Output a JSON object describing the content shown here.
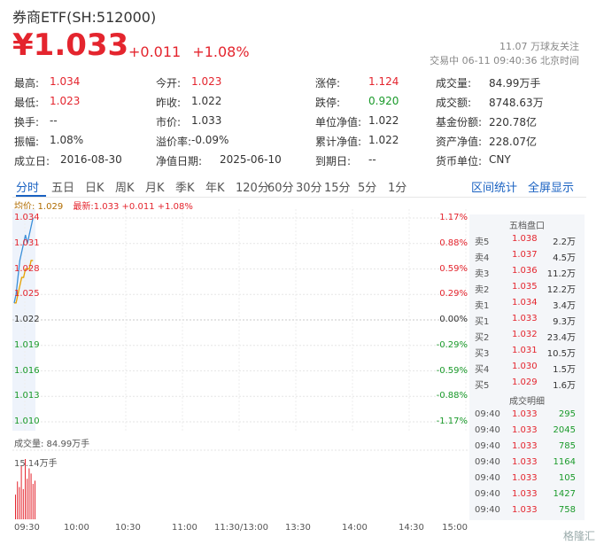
{
  "header": {
    "title": "券商ETF(SH:512000)",
    "price": "¥1.033",
    "change": "+0.011",
    "change_pct": "+1.08%",
    "followers": "11.07 万球友关注",
    "trading_status": "交易中  06-11  09:40:36  北京时间"
  },
  "stats": [
    [
      {
        "label": "最高:",
        "value": "1.034",
        "color": "red"
      },
      {
        "label": "今开:",
        "value": "1.023",
        "color": "red"
      },
      {
        "label": "涨停:",
        "value": "1.124",
        "color": "red"
      },
      {
        "label": "成交量:",
        "value": "84.99万手",
        "color": ""
      }
    ],
    [
      {
        "label": "最低:",
        "value": "1.023",
        "color": "red"
      },
      {
        "label": "昨收:",
        "value": "1.022",
        "color": ""
      },
      {
        "label": "跌停:",
        "value": "0.920",
        "color": "green"
      },
      {
        "label": "成交额:",
        "value": "8748.63万",
        "color": ""
      }
    ],
    [
      {
        "label": "换手:",
        "value": "--",
        "color": ""
      },
      {
        "label": "市价:",
        "value": "1.033",
        "color": ""
      },
      {
        "label": "单位净值:",
        "value": "1.022",
        "color": ""
      },
      {
        "label": "基金份额:",
        "value": "220.78亿",
        "color": ""
      }
    ],
    [
      {
        "label": "振幅:",
        "value": "1.08%",
        "color": ""
      },
      {
        "label": "溢价率:",
        "value": "-0.09%",
        "color": ""
      },
      {
        "label": "累计净值:",
        "value": "1.022",
        "color": ""
      },
      {
        "label": "资产净值:",
        "value": "228.07亿",
        "color": ""
      }
    ],
    [
      {
        "label": "成立日:",
        "value": "2016-08-30",
        "color": ""
      },
      {
        "label": "净值日期:",
        "value": "2025-06-10",
        "color": ""
      },
      {
        "label": "到期日:",
        "value": "--",
        "color": ""
      },
      {
        "label": "货币单位:",
        "value": "CNY",
        "color": ""
      }
    ]
  ],
  "tabs": [
    "分时",
    "五日",
    "日K",
    "周K",
    "月K",
    "季K",
    "年K",
    "120分",
    "60分",
    "30分",
    "15分",
    "5分",
    "1分"
  ],
  "tab_actions": [
    "区间统计",
    "全屏显示"
  ],
  "info_line": {
    "avg": "均价: 1.029",
    "latest": "最新:1.033  +0.011  +1.08%"
  },
  "chart_data": {
    "type": "line",
    "y_ticks": [
      "1.034",
      "1.031",
      "1.028",
      "1.025",
      "1.022",
      "1.019",
      "1.016",
      "1.013",
      "1.010"
    ],
    "pct_ticks": [
      "1.17%",
      "0.88%",
      "0.59%",
      "0.29%",
      "0.00%",
      "-0.29%",
      "-0.59%",
      "-0.88%",
      "-1.17%"
    ],
    "ylim": [
      1.01,
      1.034
    ],
    "prev_close": 1.022,
    "x_ticks": [
      "09:30",
      "10:00",
      "10:30",
      "11:00",
      "11:30/13:00",
      "13:30",
      "14:00",
      "14:30",
      "15:00"
    ],
    "price_series": {
      "x": [
        0,
        1,
        2,
        3,
        4,
        5,
        6,
        7,
        8,
        9,
        10
      ],
      "values": [
        1.024,
        1.025,
        1.027,
        1.029,
        1.03,
        1.031,
        1.032,
        1.031,
        1.032,
        1.033,
        1.034
      ]
    },
    "avg_series": {
      "x": [
        0,
        1,
        2,
        3,
        4,
        5,
        6,
        7,
        8,
        9,
        10
      ],
      "values": [
        1.024,
        1.024,
        1.025,
        1.026,
        1.027,
        1.027,
        1.028,
        1.028,
        1.028,
        1.029,
        1.029
      ]
    },
    "volume": {
      "label": "成交量: 84.99万手",
      "max_label": "15.14万手",
      "max": 15.14,
      "values": [
        6.2,
        9.5,
        8.1,
        13.4,
        7.6,
        15.14,
        10.2,
        12.8,
        11.5,
        8.9,
        9.7
      ]
    }
  },
  "order_book": {
    "title": "五档盘口",
    "asks": [
      {
        "label": "卖5",
        "price": "1.038",
        "vol": "2.2万"
      },
      {
        "label": "卖4",
        "price": "1.037",
        "vol": "4.5万"
      },
      {
        "label": "卖3",
        "price": "1.036",
        "vol": "11.2万"
      },
      {
        "label": "卖2",
        "price": "1.035",
        "vol": "12.2万"
      },
      {
        "label": "卖1",
        "price": "1.034",
        "vol": "3.4万"
      }
    ],
    "bids": [
      {
        "label": "买1",
        "price": "1.033",
        "vol": "9.3万"
      },
      {
        "label": "买2",
        "price": "1.032",
        "vol": "23.4万"
      },
      {
        "label": "买3",
        "price": "1.031",
        "vol": "10.5万"
      },
      {
        "label": "买4",
        "price": "1.030",
        "vol": "1.5万"
      },
      {
        "label": "买5",
        "price": "1.029",
        "vol": "1.6万"
      }
    ],
    "trades_title": "成交明细",
    "trades": [
      {
        "time": "09:40",
        "price": "1.033",
        "vol": "295"
      },
      {
        "time": "09:40",
        "price": "1.033",
        "vol": "2045"
      },
      {
        "time": "09:40",
        "price": "1.033",
        "vol": "785"
      },
      {
        "time": "09:40",
        "price": "1.033",
        "vol": "1164"
      },
      {
        "time": "09:40",
        "price": "1.033",
        "vol": "105"
      },
      {
        "time": "09:40",
        "price": "1.033",
        "vol": "1427"
      },
      {
        "time": "09:40",
        "price": "1.033",
        "vol": "758"
      }
    ]
  },
  "watermark": "格隆汇",
  "colors": {
    "up": "#e4252e",
    "down": "#1a9a2a",
    "accent": "#1a62c2",
    "price_line": "#3a8fd9",
    "avg_line": "#e5a100"
  }
}
